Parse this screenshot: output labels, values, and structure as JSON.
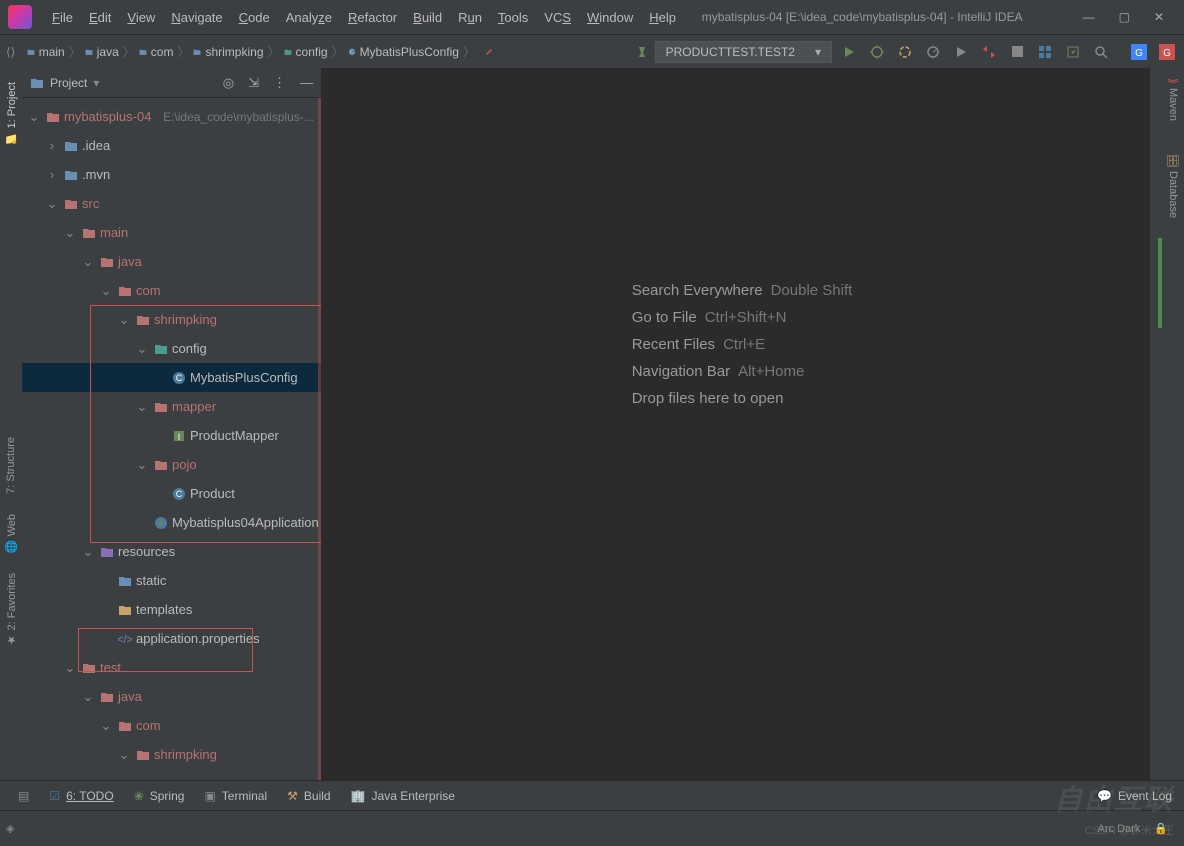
{
  "title": "mybatisplus-04 [E:\\idea_code\\mybatisplus-04] - IntelliJ IDEA",
  "menu": [
    "File",
    "Edit",
    "View",
    "Navigate",
    "Code",
    "Analyze",
    "Refactor",
    "Build",
    "Run",
    "Tools",
    "VCS",
    "Window",
    "Help"
  ],
  "breadcrumb": [
    "main",
    "java",
    "com",
    "shrimpking",
    "config",
    "MybatisPlusConfig"
  ],
  "run_config": "PRODUCTTEST.TEST2",
  "sidebar": {
    "title": "Project"
  },
  "tree": {
    "root": {
      "name": "mybatisplus-04",
      "path": "E:\\idea_code\\mybatisplus-..."
    },
    "idea": ".idea",
    "mvn": ".mvn",
    "src": "src",
    "main": "main",
    "java": "java",
    "com": "com",
    "shrimpking": "shrimpking",
    "config": "config",
    "mybatisplusconfig": "MybatisPlusConfig",
    "mapper": "mapper",
    "productmapper": "ProductMapper",
    "pojo": "pojo",
    "product": "Product",
    "app": "Mybatisplus04Application",
    "resources": "resources",
    "static": "static",
    "templates": "templates",
    "appprops": "application.properties",
    "test": "test",
    "java2": "java",
    "com2": "com",
    "shrimpking2": "shrimpking"
  },
  "hints": [
    {
      "label": "Search Everywhere",
      "kb": "Double Shift"
    },
    {
      "label": "Go to File",
      "kb": "Ctrl+Shift+N"
    },
    {
      "label": "Recent Files",
      "kb": "Ctrl+E"
    },
    {
      "label": "Navigation Bar",
      "kb": "Alt+Home"
    },
    {
      "label": "Drop files here to open",
      "kb": ""
    }
  ],
  "left_tabs": [
    "1: Project",
    "7: Structure",
    "Web",
    "2: Favorites"
  ],
  "right_tabs": [
    {
      "icon": "maven",
      "label": "Maven"
    },
    {
      "icon": "db",
      "label": "Database"
    }
  ],
  "statusbar": [
    {
      "icon": "todo",
      "label": "6: TODO"
    },
    {
      "icon": "spring",
      "label": "Spring"
    },
    {
      "icon": "terminal",
      "label": "Terminal"
    },
    {
      "icon": "build",
      "label": "Build"
    },
    {
      "icon": "jee",
      "label": "Java Enterprise"
    }
  ],
  "footer": {
    "event": "Event Log",
    "theme": "Arc Dark"
  },
  "watermark": {
    "big": "自由互联",
    "small": "CSDN @虾米大王"
  }
}
